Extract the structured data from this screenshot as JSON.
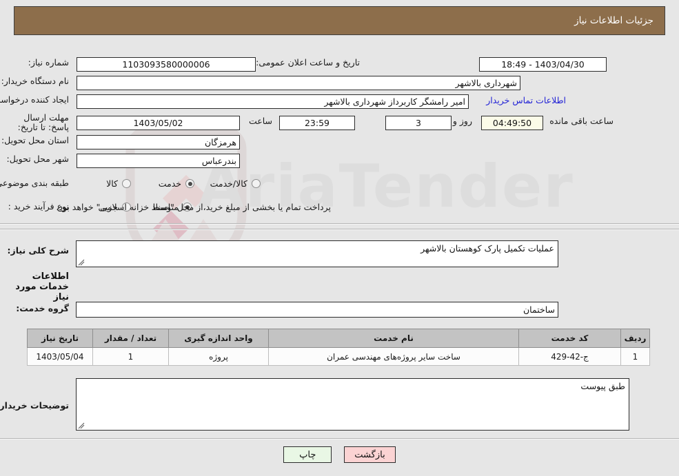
{
  "header": {
    "title": "جزئیات اطلاعات نیاز"
  },
  "form": {
    "need_number_label": "شماره نیاز:",
    "need_number_value": "1103093580000006",
    "announce_datetime_label": "تاریخ و ساعت اعلان عمومی:",
    "announce_datetime_value": "18:49 - 1403/04/30",
    "buyer_org_label": "نام دستگاه خریدار:",
    "buyer_org_value": "شهرداری بالاشهر",
    "requester_label": "ایجاد کننده درخواست:",
    "requester_value": "امیر رامشگر کاربرداز شهرداری بالاشهر",
    "buyer_contact_link": "اطلاعات تماس خریدار",
    "buyer_contact_value": "",
    "deadline_label": "مهلت ارسال پاسخ: تا تاریخ:",
    "deadline_date": "1403/05/02",
    "deadline_hour_label": "ساعت",
    "deadline_hour_value": "23:59",
    "remaining_days": "3",
    "remaining_days_text": "روز و",
    "countdown_value": "04:49:50",
    "countdown_text": "ساعت باقی مانده",
    "province_label": "استان محل تحویل:",
    "province_value": "هرمزگان",
    "city_label": "شهر محل تحویل:",
    "city_value": "بندرعباس",
    "category_label": "طبقه بندی موضوعی:",
    "category_options": [
      {
        "label": "کالا",
        "selected": false
      },
      {
        "label": "خدمت",
        "selected": true
      },
      {
        "label": "کالا/خدمت",
        "selected": false
      }
    ],
    "process_label": "نوع فرآیند خرید :",
    "process_options": [
      {
        "label": "جزیی",
        "selected": false
      },
      {
        "label": "متوسط",
        "selected": true
      }
    ],
    "process_note": "پرداخت تمام یا بخشی از مبلغ خرید،از محل \"اسناد خزانه اسلامی\" خواهد بود."
  },
  "need_description": {
    "label": "شرح کلی نیاز:",
    "value": "عملیات تکمیل پارک کوهستان بالاشهر"
  },
  "services_section": {
    "heading": "اطلاعات خدمات مورد نیاز",
    "group_label": "گروه خدمت:",
    "group_value": "ساختمان"
  },
  "table": {
    "columns": [
      "ردیف",
      "کد خدمت",
      "نام خدمت",
      "واحد اندازه گیری",
      "تعداد / مقدار",
      "تاریخ نیاز"
    ],
    "rows": [
      {
        "index": "1",
        "code": "ج-42-429",
        "name": "ساخت سایر پروژه‌های مهندسی عمران",
        "unit": "پروژه",
        "quantity": "1",
        "need_date": "1403/05/04"
      }
    ]
  },
  "buyer_notes": {
    "label": "توضیحات خریدار:",
    "value": "طبق پیوست"
  },
  "buttons": {
    "print": "چاپ",
    "back": "بازگشت"
  },
  "colors": {
    "header_bg": "#8d6e4b",
    "page_bg": "#e6e6e6",
    "link": "#2323d6",
    "countdown_bg": "#fbfbe8",
    "print_bg": "#e9f7e5",
    "back_bg": "#fbd3d3",
    "table_header_bg": "#c3c3c3"
  },
  "watermark": {
    "text": "AriaTender"
  }
}
